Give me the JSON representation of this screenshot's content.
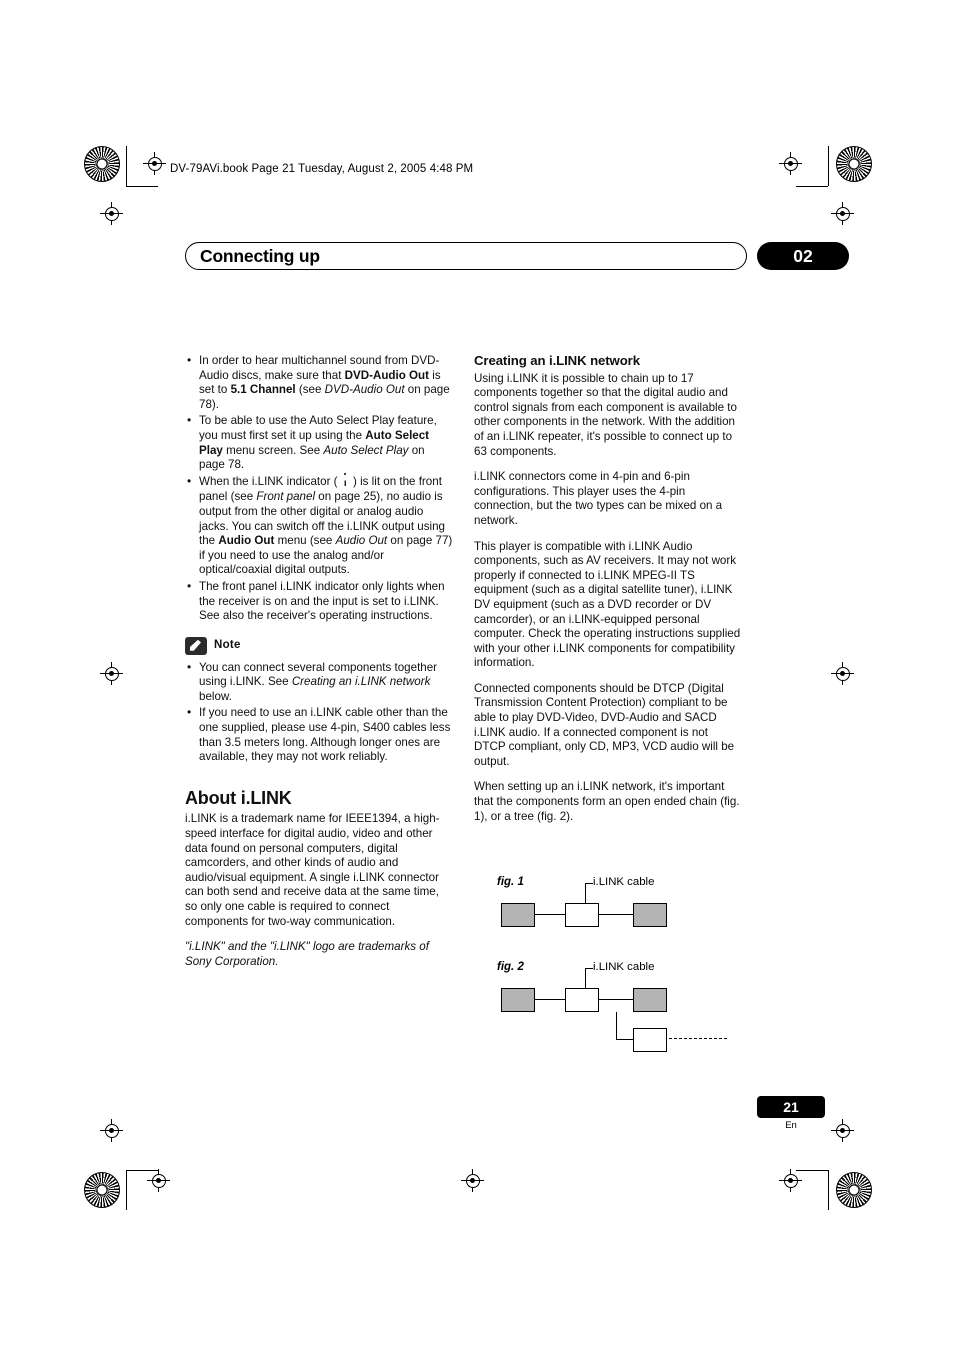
{
  "header": {
    "file_line": "DV-79AVi.book  Page 21  Tuesday, August 2, 2005  4:48 PM"
  },
  "chapter": {
    "title": "Connecting up",
    "number": "02"
  },
  "left_column": {
    "bullets": [
      {
        "parts": [
          {
            "t": "In order to hear multichannel sound from DVD-Audio discs, make sure that ",
            "s": "n"
          },
          {
            "t": "DVD-Audio Out",
            "s": "b"
          },
          {
            "t": " is set to ",
            "s": "n"
          },
          {
            "t": "5.1 Channel",
            "s": "b"
          },
          {
            "t": " (see ",
            "s": "n"
          },
          {
            "t": "DVD-Audio Out",
            "s": "i"
          },
          {
            "t": " on page 78).",
            "s": "n"
          }
        ]
      },
      {
        "parts": [
          {
            "t": "To be able to use the Auto Select Play feature, you must first set it up using the ",
            "s": "n"
          },
          {
            "t": "Auto Select Play",
            "s": "b"
          },
          {
            "t": " menu screen. See ",
            "s": "n"
          },
          {
            "t": "Auto Select Play",
            "s": "i"
          },
          {
            "t": " on page 78.",
            "s": "n"
          }
        ]
      },
      {
        "parts": [
          {
            "t": "When the i.LINK indicator ( ",
            "s": "n"
          },
          {
            "t": "ICON",
            "s": "icon"
          },
          {
            "t": " ) is lit on the front panel (see ",
            "s": "n"
          },
          {
            "t": "Front panel",
            "s": "i"
          },
          {
            "t": " on page 25), no audio is output from the other digital or analog audio jacks. You can switch off the i.LINK output using the ",
            "s": "n"
          },
          {
            "t": "Audio Out",
            "s": "b"
          },
          {
            "t": " menu (see ",
            "s": "n"
          },
          {
            "t": "Audio Out",
            "s": "i"
          },
          {
            "t": " on page 77) if you need to use the analog and/or optical/coaxial digital outputs.",
            "s": "n"
          }
        ]
      },
      {
        "parts": [
          {
            "t": "The front panel i.LINK indicator only lights when the receiver is on and the input is set to i.LINK. See also the receiver's operating instructions.",
            "s": "n"
          }
        ]
      }
    ],
    "note_label": "Note",
    "note_bullets": [
      {
        "parts": [
          {
            "t": "You can connect several components together using i.LINK. See ",
            "s": "n"
          },
          {
            "t": "Creating an i.LINK network",
            "s": "i"
          },
          {
            "t": " below.",
            "s": "n"
          }
        ]
      },
      {
        "parts": [
          {
            "t": "If you need to use an i.LINK cable other than the one supplied, please use 4-pin, S400 cables less than 3.5 meters long. Although longer ones are available, they may not work reliably.",
            "s": "n"
          }
        ]
      }
    ],
    "section_heading": "About i.LINK",
    "section_paragraph": "i.LINK is a trademark name for IEEE1394, a high-speed interface for digital audio, video and other data found on personal computers, digital camcorders, and other kinds of audio and audio/visual equipment. A single i.LINK connector can both send and receive data at the same time, so only one cable is required to connect components for two-way communication.",
    "trademark_note": "\"i.LINK\" and the \"i.LINK\" logo are trademarks of Sony Corporation."
  },
  "right_column": {
    "heading": "Creating an i.LINK network",
    "paragraphs": [
      "Using i.LINK it is possible to chain up to 17 components together so that the digital audio and control signals from each component is available to other components in the network. With the addition of an i.LINK repeater, it's possible to connect up to 63 components.",
      "i.LINK connectors come in 4-pin and 6-pin configurations. This player uses the 4-pin connection, but the two types can be mixed on a network.",
      "This player is compatible with i.LINK Audio components, such as AV receivers. It may not work properly if connected to i.LINK MPEG-II TS equipment (such as a digital satellite tuner), i.LINK DV equipment (such as a DVD recorder or DV camcorder), or an i.LINK-equipped personal computer. Check the operating instructions supplied with your other i.LINK components for compatibility information.",
      "Connected components should be DTCP (Digital Transmission Content Protection) compliant to be able to play DVD-Video, DVD-Audio and SACD i.LINK audio. If a connected component is not DTCP compliant, only CD, MP3, VCD audio will be output.",
      "When setting up an i.LINK network, it's important that the components form an open ended chain (fig. 1), or a tree (fig. 2)."
    ],
    "figures": [
      {
        "label": "fig. 1",
        "cable_caption": "i.LINK cable"
      },
      {
        "label": "fig. 2",
        "cable_caption": "i.LINK cable"
      }
    ]
  },
  "footer": {
    "page_number": "21",
    "language_code": "En"
  }
}
